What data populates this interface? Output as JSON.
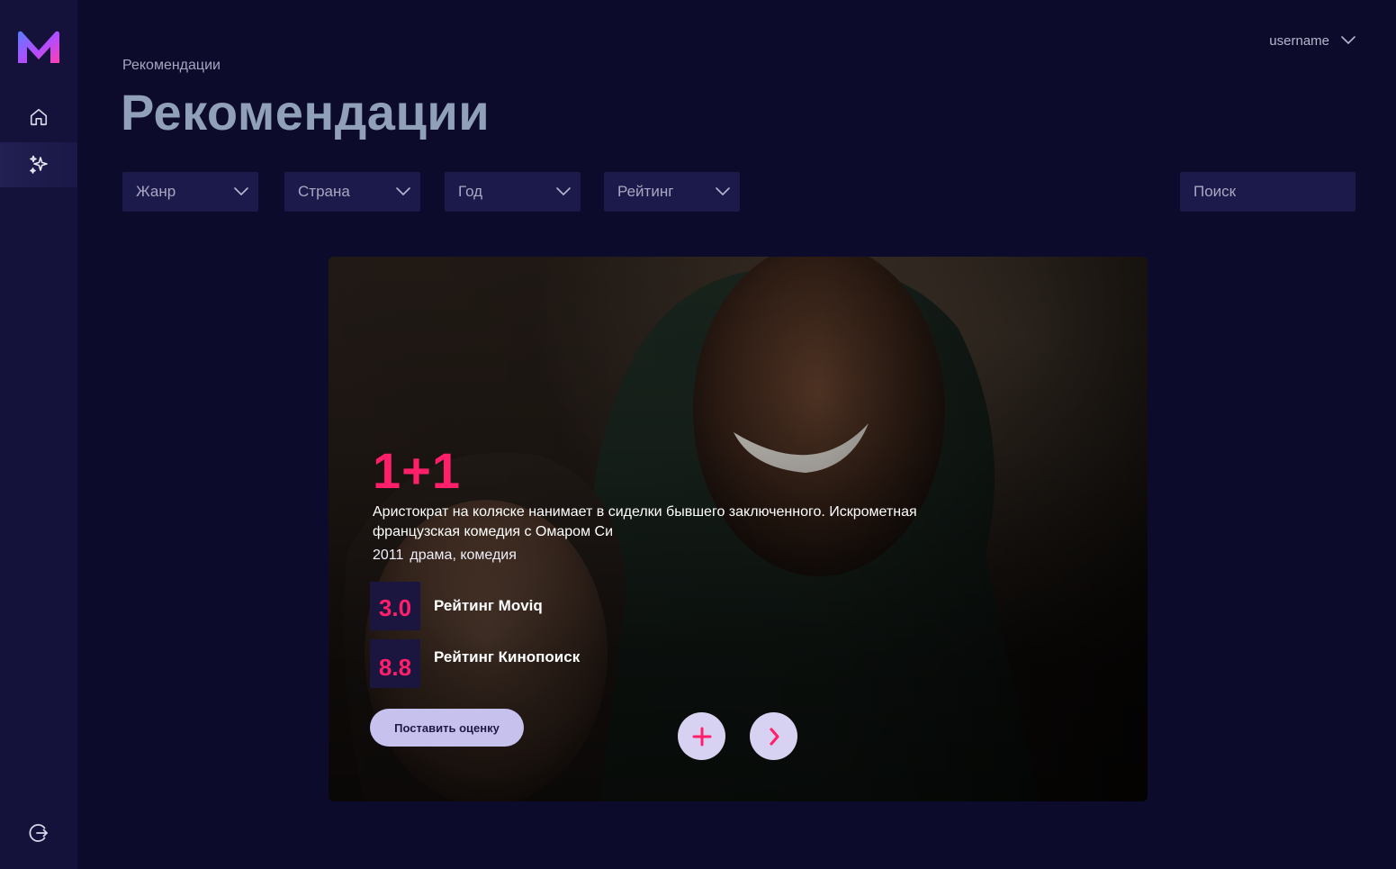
{
  "colors": {
    "background": "#0d0b2b",
    "sidebar": "#14123a",
    "accent": "#ff1f6b",
    "filter_bg": "#1c1a4a",
    "button_bg": "#c7c1ee"
  },
  "sidebar": {
    "logo_icon": "moviq-m-logo-icon",
    "items": [
      {
        "icon": "home-icon",
        "active": false
      },
      {
        "icon": "sparkles-icon",
        "active": true
      }
    ],
    "logout_icon": "logout-icon"
  },
  "header": {
    "username": "username",
    "breadcrumb": "Рекомендации",
    "title": "Рекомендации"
  },
  "filters": {
    "genre": "Жанр",
    "country": "Страна",
    "year": "Год",
    "rating": "Рейтинг",
    "search_placeholder": "Поиск"
  },
  "movie": {
    "title": "1+1",
    "description": "Аристократ на коляске нанимает в сиделки бывшего заключенного. Искрометная французская комедия с Омаром Си",
    "year": "2011",
    "genres": "драма, комедия",
    "ratings": [
      {
        "value": "3.0",
        "label": "Рейтинг Moviq"
      },
      {
        "value": "8.8",
        "label": "Рейтинг Кинопоиск"
      }
    ],
    "rate_button": "Поставить оценку"
  }
}
